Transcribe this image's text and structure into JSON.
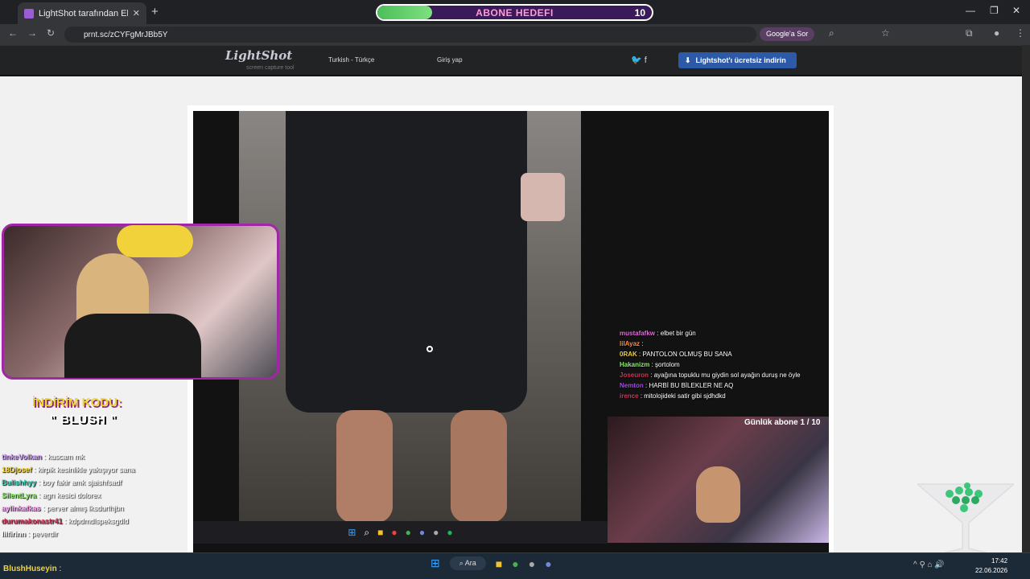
{
  "browser": {
    "tab_title": "LightShot tarafından Ekran Gör",
    "url": "prnt.sc/zCYFgMrJBb5Y",
    "google_sor": "Google'a Sor"
  },
  "goal_bar": {
    "label": "ABONE HEDEFI",
    "count": "10",
    "progress": 0.2
  },
  "lightshot": {
    "logo": "LightShot",
    "logo_sub": "screen capture tool",
    "language": "Turkish - Türkçe",
    "login": "Giriş yap",
    "download": "Lightshot'ı ücretsiz indirin"
  },
  "overlay_chat": [
    {
      "user": "mustafafkw",
      "msg": ": elbet bir gün",
      "color": "#e06ad8"
    },
    {
      "user": "lilAyaz",
      "msg": ":",
      "color": "#ff8a3d"
    },
    {
      "user": "0RAK",
      "msg": ": PANTOLON OLMUŞ BU SANA",
      "color": "#f1d23a"
    },
    {
      "user": "Hakanizm",
      "msg": ": şortolom",
      "color": "#8df06a"
    },
    {
      "user": "Joseuron",
      "msg": ": ayağına topuklu mu giydin sol ayağın duruş ne öyle",
      "color": "#c83a5a"
    },
    {
      "user": "Nemton",
      "msg": ": HARBİ BU BİLEKLER NE AQ",
      "color": "#a24ce0"
    },
    {
      "user": "irence",
      "msg": ": mitolojideki satir gibi sjdhdkd",
      "color": "#c83a5a"
    }
  ],
  "abone_text": "Günlük abone 1 / 10",
  "promo": {
    "line1": "İNDİRİM KODU:",
    "line2": "\" BLUSH \""
  },
  "left_chat": [
    {
      "user": "tinkeVolkan",
      "msg": ": kuscam mk",
      "color": "#c99cf0"
    },
    {
      "user": "18Djosef",
      "msg": ": kirpik kesinlikle yakışıyor sana",
      "color": "#f1d23a"
    },
    {
      "user": "Bulishhyy",
      "msg": ": boy fakir amk sjaishfsadf",
      "color": "#3cc6b0"
    },
    {
      "user": "SilentLyra",
      "msg": ": agrı kesici dolorex",
      "color": "#8df06a"
    },
    {
      "user": "aylinkafkas",
      "msg": ": perver almış lksdurfhjbn",
      "color": "#f8a8f0"
    },
    {
      "user": "durumakonastr41",
      "msg": ": kdpdmdlspeksgdld",
      "color": "#c83a5a"
    },
    {
      "user": "lilfirinn",
      "msg": ": peverdir",
      "color": "#ffffff"
    }
  ],
  "taskbar_chat": {
    "user": "BlushHuseyin",
    "msg": ":"
  },
  "taskbar": {
    "search": "Ara",
    "time": "17:42",
    "date": "22.06.2026"
  },
  "colors": {
    "accent": "#a127a6",
    "goal_fill": "#4bbf58",
    "download_btn": "#2c5aa8"
  }
}
